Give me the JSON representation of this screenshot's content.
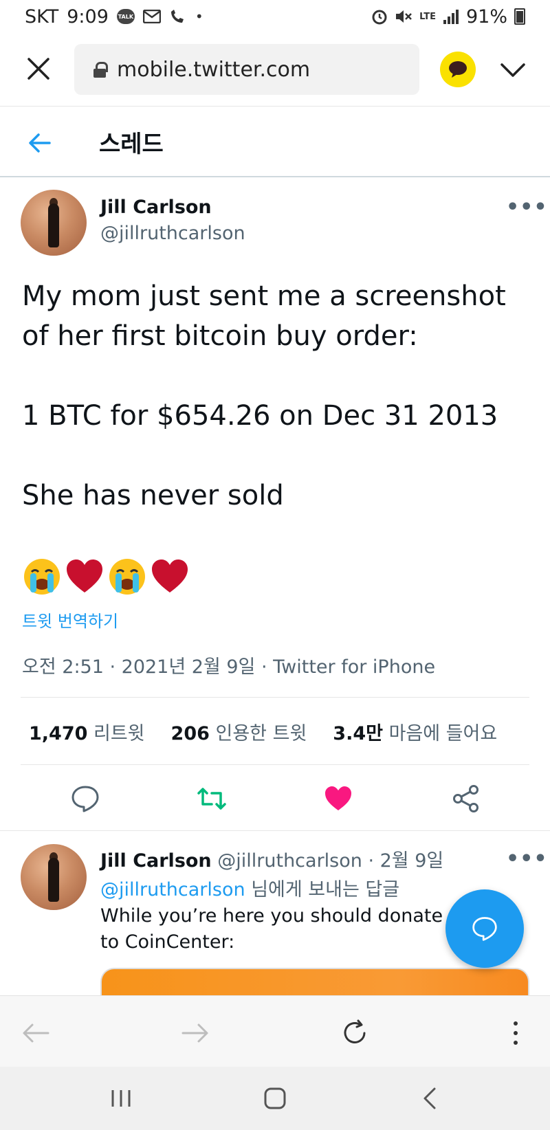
{
  "status_bar": {
    "carrier": "SKT",
    "time": "9:09",
    "talk_icon_label": "TALK",
    "network": "LTE",
    "battery": "91%"
  },
  "browser": {
    "url": "mobile.twitter.com"
  },
  "thread": {
    "title": "스레드"
  },
  "tweet": {
    "name": "Jill Carlson",
    "handle": "@jillruthcarlson",
    "more": "•••",
    "lines": [
      "My mom just sent me a screenshot of her first bitcoin buy order:",
      "1 BTC for $654.26 on Dec 31 2013",
      "She has never sold"
    ],
    "emojis": [
      "😭",
      "❤️",
      "😭",
      "❤️"
    ],
    "translate": "트윗 번역하기",
    "meta": "오전 2:51 · 2021년 2월 9일 · Twitter for iPhone"
  },
  "stats": {
    "retweets_count": "1,470",
    "retweets_label": "리트윗",
    "quotes_count": "206",
    "quotes_label": "인용한 트윗",
    "likes_count": "3.4만",
    "likes_label": "마음에 들어요"
  },
  "colors": {
    "accent": "#1d9bf0",
    "retweet": "#00ba7c",
    "like": "#f91880",
    "kakao": "#fae100"
  },
  "reply": {
    "name": "Jill Carlson",
    "handle": "@jillruthcarlson",
    "date": "· 2월 9일",
    "more": "•••",
    "mention": "@jillruthcarlson",
    "replying_suffix": " 님에게 보내는 답글",
    "text": "While you’re here you should donate to CoinCenter:"
  }
}
